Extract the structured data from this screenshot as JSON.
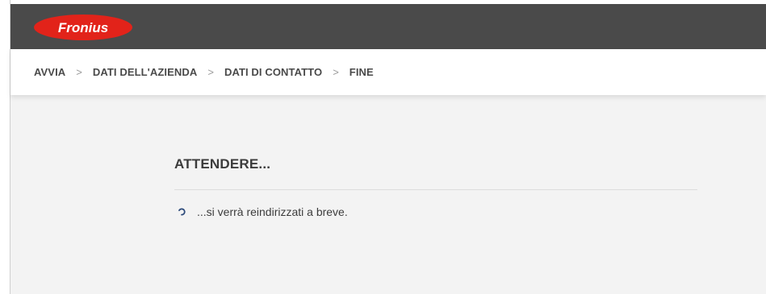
{
  "header": {
    "logo_text": "Fronius",
    "colors": {
      "bar": "#4a4a4a",
      "logo_red": "#e2231a"
    }
  },
  "breadcrumb": {
    "items": [
      {
        "label": "AVVIA"
      },
      {
        "label": "DATI DELL'AZIENDA"
      },
      {
        "label": "DATI DI CONTATTO"
      },
      {
        "label": "FINE"
      }
    ],
    "separator": ">"
  },
  "main": {
    "title": "ATTENDERE...",
    "status_text": "...si verrà reindirizzati a breve.",
    "spinner_icon": "loading-spinner-icon",
    "spinner_color": "#2c4a7a"
  }
}
